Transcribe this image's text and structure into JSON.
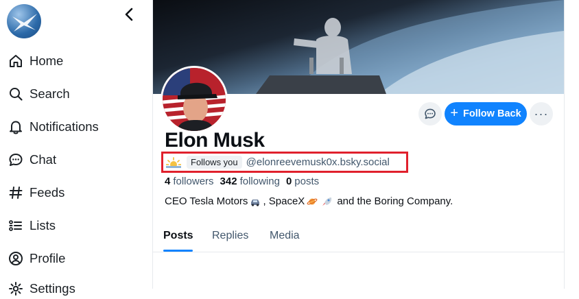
{
  "sidebar": {
    "logo_icon": "butterfly-logo-icon",
    "collapse_icon": "chevron-left-icon",
    "items": [
      {
        "icon": "home-icon",
        "label": "Home"
      },
      {
        "icon": "search-icon",
        "label": "Search"
      },
      {
        "icon": "bell-icon",
        "label": "Notifications"
      },
      {
        "icon": "chat-bubble-icon",
        "label": "Chat"
      },
      {
        "icon": "hash-icon",
        "label": "Feeds"
      },
      {
        "icon": "list-icon",
        "label": "Lists"
      },
      {
        "icon": "user-circle-icon",
        "label": "Profile"
      },
      {
        "icon": "gear-icon",
        "label": "Settings"
      }
    ]
  },
  "profile": {
    "display_name": "Elon Musk",
    "follows_you_label": "Follows you",
    "handle": "@elonreevemusk0x.bsky.social",
    "stats": {
      "followers_count": "4",
      "followers_label": "followers",
      "following_count": "342",
      "following_label": "following",
      "posts_count": "0",
      "posts_label": "posts"
    },
    "bio": {
      "part1": "CEO Tesla Motors",
      "part2": ", SpaceX",
      "part3": "and  the Boring Company."
    },
    "follow_back_label": "Follow Back",
    "more_label": "···"
  },
  "tabs": [
    {
      "label": "Posts",
      "active": true
    },
    {
      "label": "Replies",
      "active": false
    },
    {
      "label": "Media",
      "active": false
    }
  ],
  "colors": {
    "accent": "#1083fe",
    "highlight_box": "#e0202c"
  }
}
